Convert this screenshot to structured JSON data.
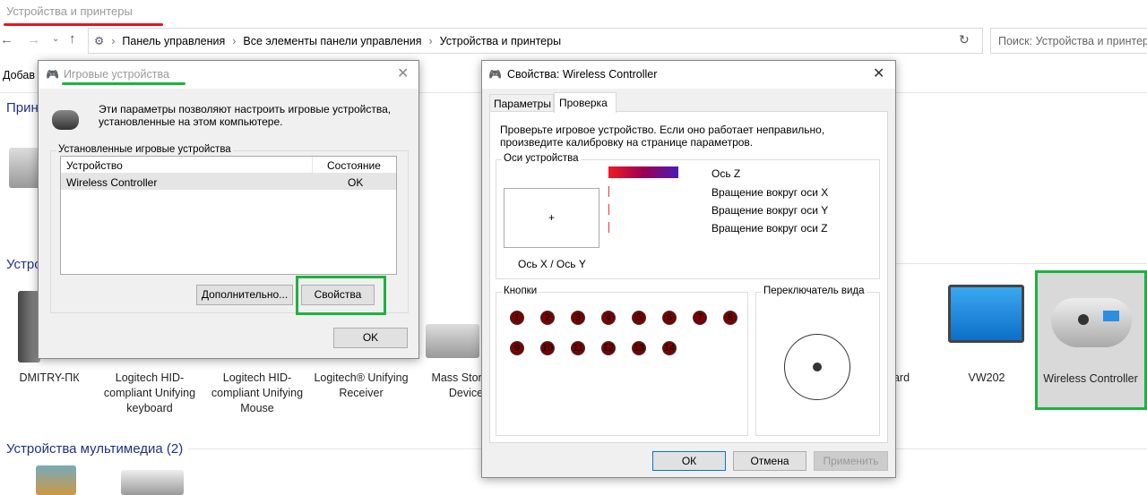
{
  "explorer": {
    "title": "Устройства и принтеры",
    "breadcrumb": [
      "Панель управления",
      "Все элементы панели управления",
      "Устройства и принтеры"
    ],
    "search_placeholder": "Поиск: Устройства и принтеры",
    "toolbar_add": "Добав",
    "sections": {
      "printers": "Принт",
      "devices": "Устройства",
      "multimedia": "Устройства мультимедиа (2)"
    },
    "devices": [
      "DMITRY-ПК",
      "Logitech HID-compliant Unifying keyboard",
      "Logitech HID-compliant Unifying Mouse",
      "Logitech® Unifying Receiver",
      "Mass Storage Device",
      "oard",
      "VW202",
      "Wireless Controller"
    ]
  },
  "game_dialog": {
    "title": "Игровые устройства",
    "description": "Эти параметры позволяют настроить игровые устройства, установленные на этом компьютере.",
    "group": "Установленные игровые устройства",
    "columns": [
      "Устройство",
      "Состояние"
    ],
    "rows": [
      {
        "device": "Wireless Controller",
        "status": "OK"
      }
    ],
    "advanced": "Дополнительно...",
    "properties": "Свойства",
    "ok": "OK"
  },
  "props_dialog": {
    "title": "Свойства: Wireless Controller",
    "tabs": [
      "Параметры",
      "Проверка"
    ],
    "active_tab": "Проверка",
    "instructions": "Проверьте игровое устройство. Если оно работает неправильно, произведите калибровку на странице параметров.",
    "axes_group": "Оси устройства",
    "xy_label": "Ось X / Ось Y",
    "axes": [
      "Ось Z",
      "Вращение вокруг оси X",
      "Вращение вокруг оси Y",
      "Вращение вокруг оси Z"
    ],
    "z_axis_level": 0.8,
    "buttons_group": "Кнопки",
    "buttons": [
      "1",
      "2",
      "3",
      "4",
      "5",
      "6",
      "7",
      "8",
      "9",
      "10",
      "11",
      "12",
      "13",
      "14"
    ],
    "pov_group": "Переключатель вида",
    "ok": "ОК",
    "cancel": "Отмена",
    "apply": "Применить"
  },
  "colors": {
    "highlight": "#1db23f",
    "underline_red": "#e8141c",
    "section": "#1e3287"
  }
}
